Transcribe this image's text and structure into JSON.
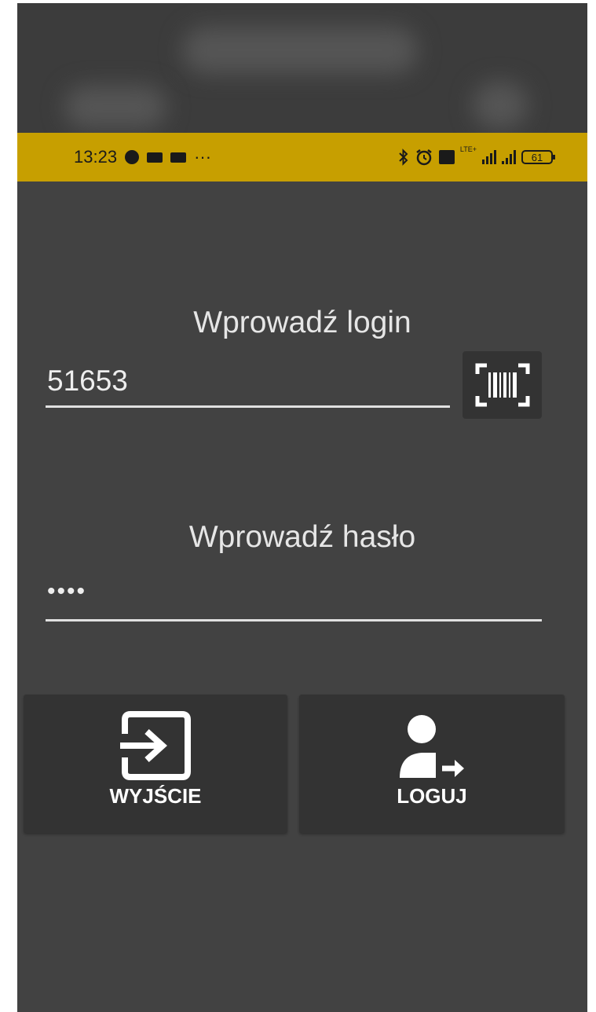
{
  "status_bar": {
    "time": "13:23",
    "more": "···",
    "battery_level": "61",
    "network_label": "LTE+",
    "background_color": "#c79f00"
  },
  "login": {
    "label": "Wprowadź login",
    "value": "51653",
    "scan_icon": "barcode-scanner-icon"
  },
  "password": {
    "label": "Wprowadź hasło",
    "masked_value": "••••"
  },
  "buttons": {
    "exit": {
      "label": "WYJŚCIE",
      "icon": "exit-icon"
    },
    "login": {
      "label": "LOGUJ",
      "icon": "user-login-icon"
    }
  },
  "colors": {
    "background": "#424242",
    "button_bg": "#333333",
    "text": "#ffffff"
  }
}
